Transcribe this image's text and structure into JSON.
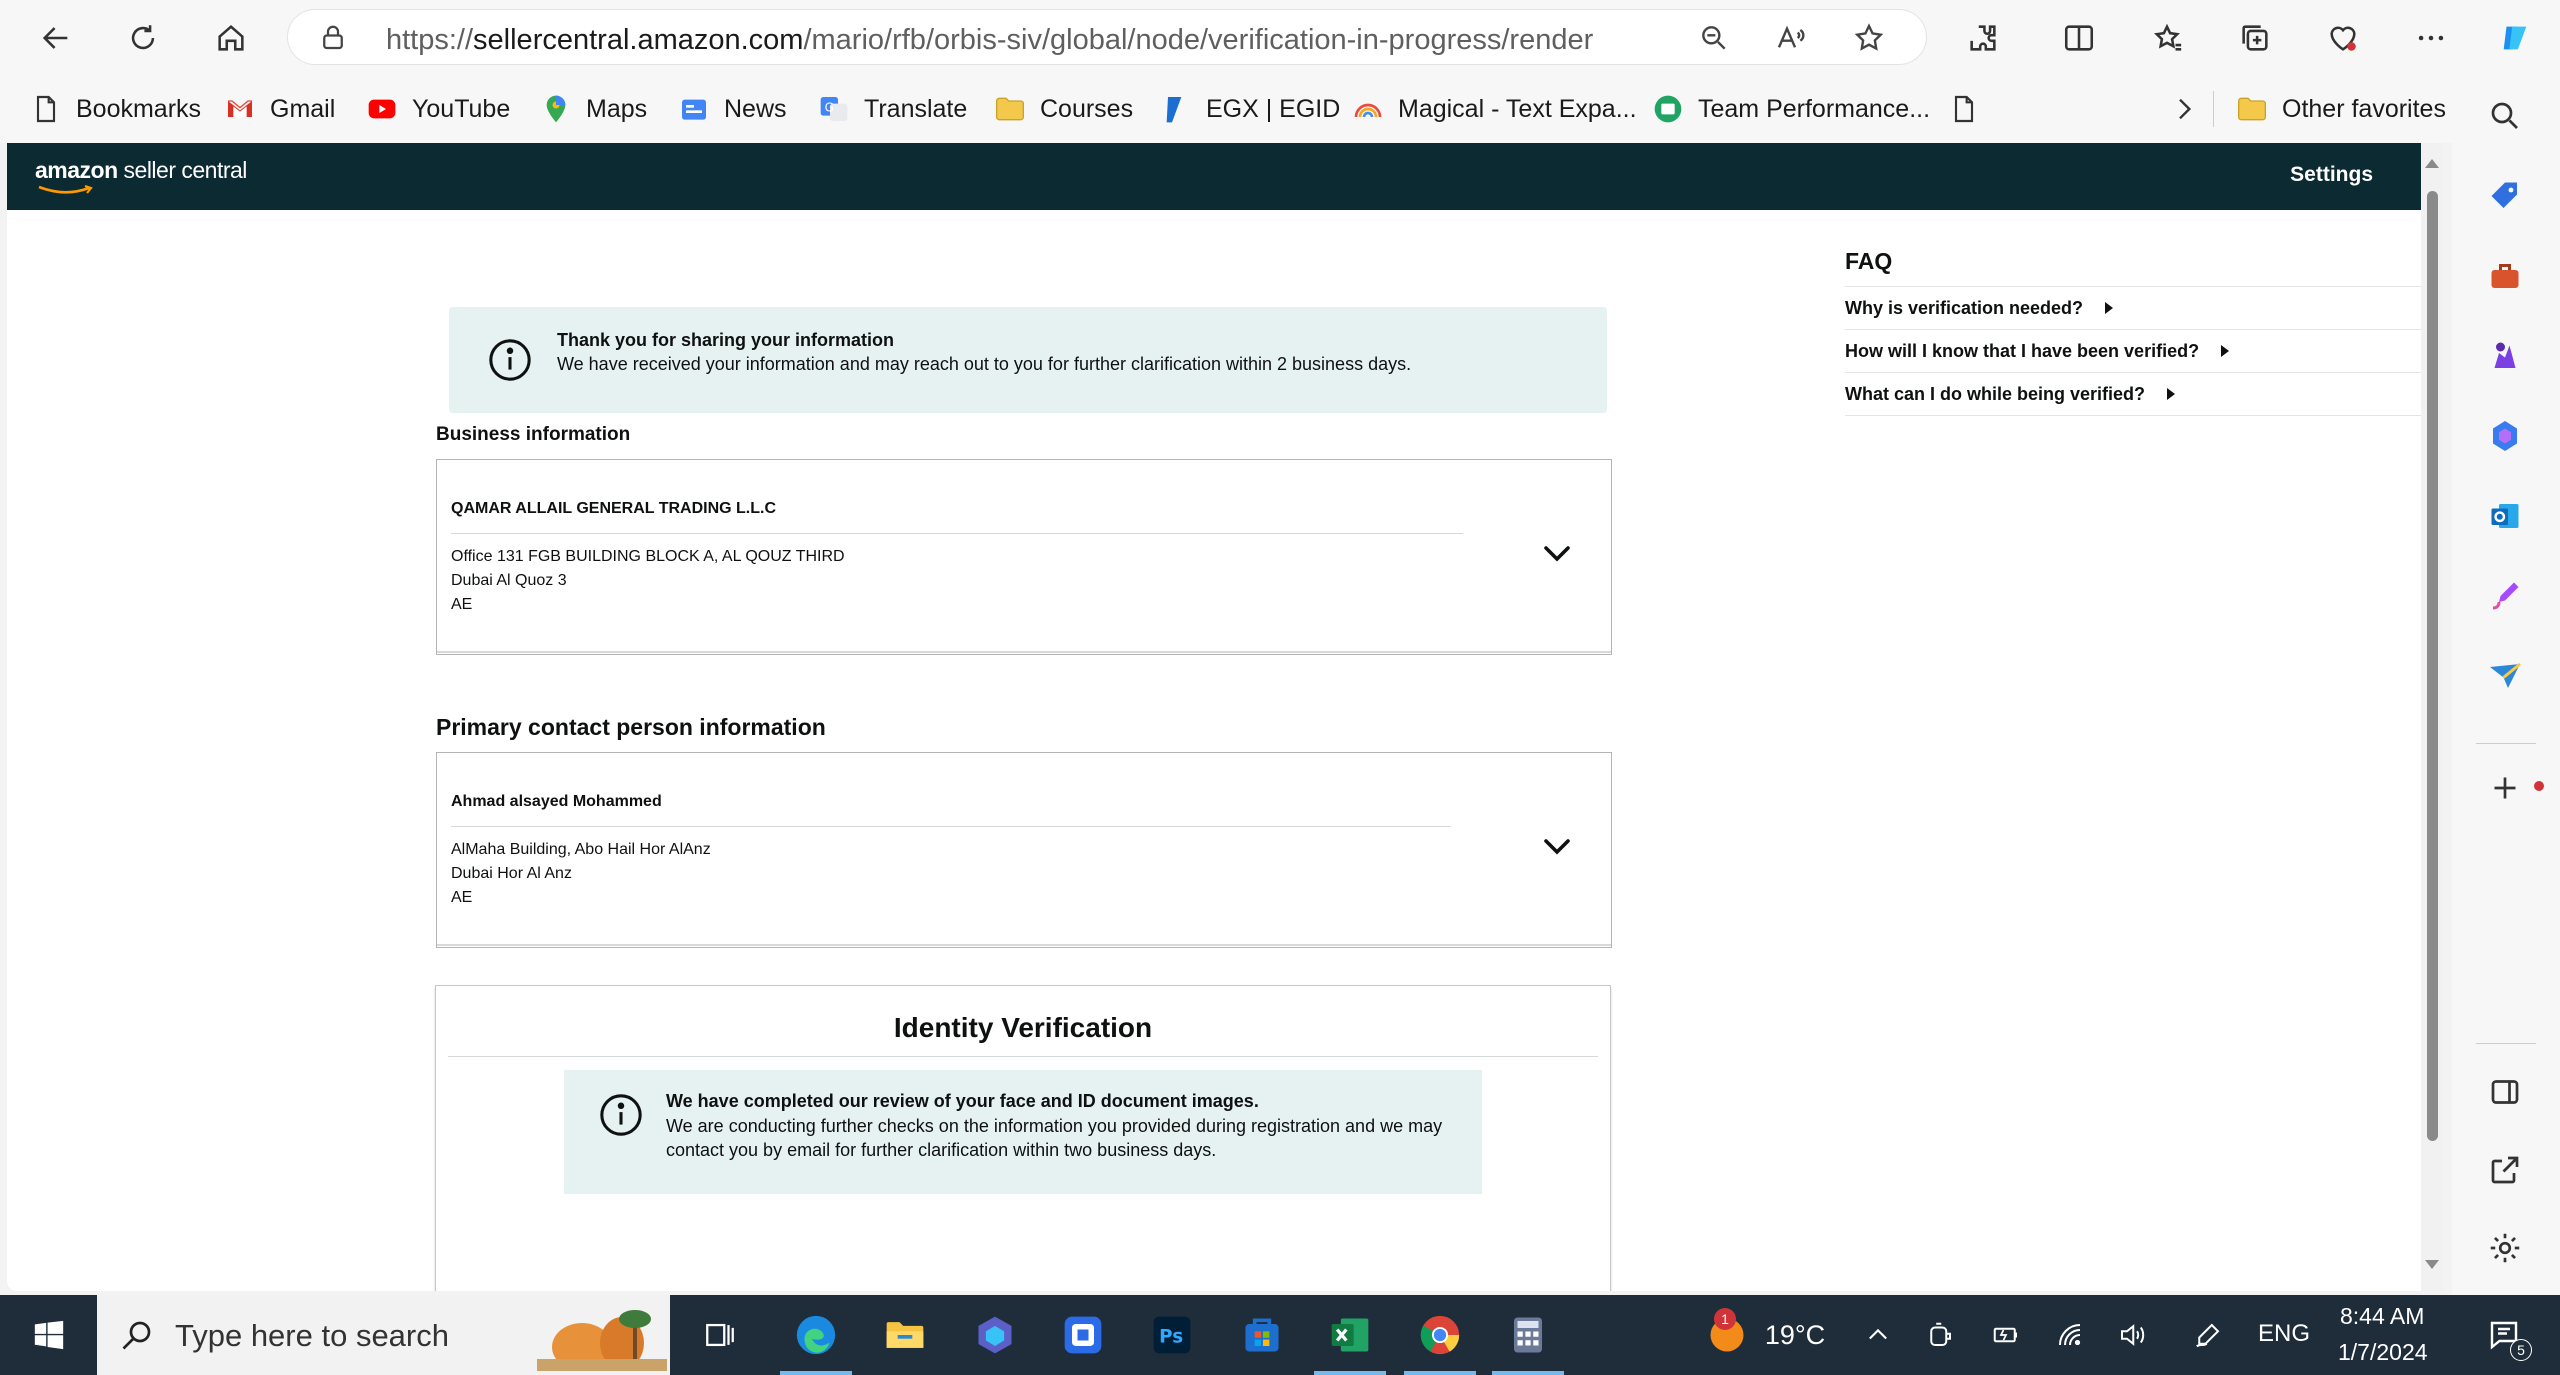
{
  "browser": {
    "url_prefix": "https://",
    "url_domain": "sellercentral.amazon.com",
    "url_path": "/mario/rfb/orbis-siv/global/node/verification-in-progress/render",
    "bookmarks": [
      {
        "label": "Bookmarks",
        "icon": "page-icon"
      },
      {
        "label": "Gmail",
        "icon": "gmail-icon"
      },
      {
        "label": "YouTube",
        "icon": "youtube-icon"
      },
      {
        "label": "Maps",
        "icon": "maps-icon"
      },
      {
        "label": "News",
        "icon": "news-icon"
      },
      {
        "label": "Translate",
        "icon": "translate-icon"
      },
      {
        "label": "Courses",
        "icon": "folder-icon"
      },
      {
        "label": "EGX | EGID",
        "icon": "egx-icon"
      },
      {
        "label": "Magical - Text Expa...",
        "icon": "magical-icon"
      },
      {
        "label": "Team Performance...",
        "icon": "team-icon"
      }
    ],
    "other_favorites": "Other favorites"
  },
  "header": {
    "logo_bold": "amazon",
    "logo_rest": " seller central",
    "settings": "Settings"
  },
  "notice": {
    "title": "Thank you for sharing your information",
    "body": "We have received your information and may reach out to you for further clarification within 2 business days."
  },
  "business": {
    "label": "Business information",
    "name": "QAMAR ALLAIL GENERAL TRADING L.L.C",
    "address_line1": "Office 131 FGB BUILDING BLOCK A, AL QOUZ THIRD",
    "address_line2": "Dubai Al Quoz 3",
    "address_line3": "AE"
  },
  "contact": {
    "label": "Primary contact person information",
    "name": "Ahmad alsayed Mohammed",
    "address_line1": "AlMaha Building, Abo Hail Hor AlAnz",
    "address_line2": "Dubai Hor Al Anz",
    "address_line3": "AE"
  },
  "identity": {
    "title": "Identity Verification",
    "alert_title": "We have completed our review of your face and ID document images.",
    "alert_body": "We are conducting further checks on the information you provided during registration and we may contact you by email for further clarification within two business days."
  },
  "faq": {
    "title": "FAQ",
    "items": [
      "Why is verification needed?",
      "How will I know that I have been verified?",
      "What can I do while being verified?"
    ]
  },
  "taskbar": {
    "search_placeholder": "Type here to search",
    "weather_temp": "19°C",
    "weather_badge": "1",
    "language": "ENG",
    "time": "8:44 AM",
    "date": "1/7/2024",
    "notification_count": "5"
  },
  "colors": {
    "header_bg": "#0b2a32",
    "alert_bg": "#e6f1f2",
    "taskbar_bg": "#1f2d3a"
  }
}
